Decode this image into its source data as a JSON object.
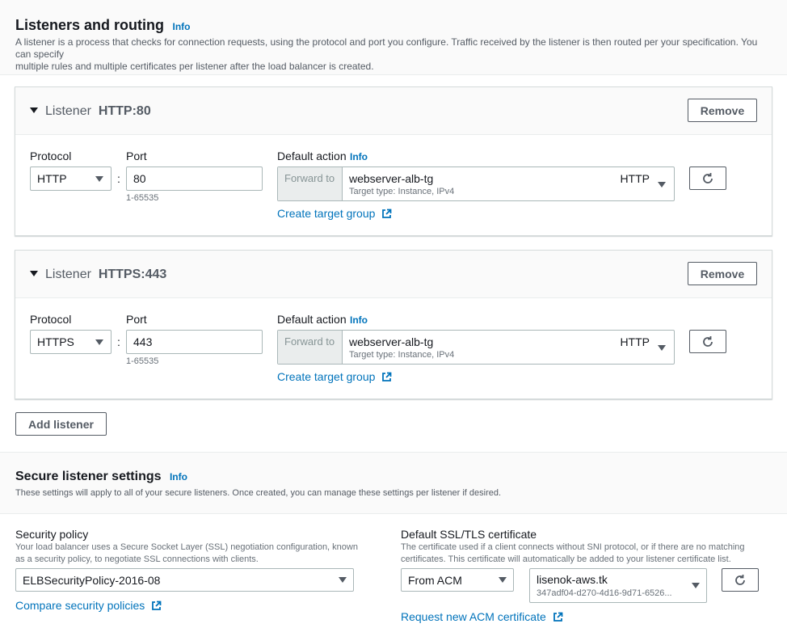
{
  "listeners_section": {
    "title": "Listeners and routing",
    "info": "Info",
    "description_1": "A listener is a process that checks for connection requests, using the protocol and port you configure. Traffic received by the listener is then routed per your specification. You can specify",
    "description_2": "multiple rules and multiple certificates per listener after the load balancer is created."
  },
  "listeners": [
    {
      "title_prefix": "Listener",
      "title_value": "HTTP:80",
      "remove_label": "Remove",
      "protocol_label": "Protocol",
      "protocol_value": "HTTP",
      "port_label": "Port",
      "port_value": "80",
      "port_hint": "1-65535",
      "default_action_label": "Default action",
      "info": "Info",
      "forward_to": "Forward to",
      "target_group": "webserver-alb-tg",
      "target_type": "Target type: Instance, IPv4",
      "target_protocol": "HTTP",
      "create_target_group": "Create target group"
    },
    {
      "title_prefix": "Listener",
      "title_value": "HTTPS:443",
      "remove_label": "Remove",
      "protocol_label": "Protocol",
      "protocol_value": "HTTPS",
      "port_label": "Port",
      "port_value": "443",
      "port_hint": "1-65535",
      "default_action_label": "Default action",
      "info": "Info",
      "forward_to": "Forward to",
      "target_group": "webserver-alb-tg",
      "target_type": "Target type: Instance, IPv4",
      "target_protocol": "HTTP",
      "create_target_group": "Create target group"
    }
  ],
  "add_listener_label": "Add listener",
  "secure_section": {
    "title": "Secure listener settings",
    "info": "Info",
    "description": "These settings will apply to all of your secure listeners. Once created, you can manage these settings per listener if desired."
  },
  "security_policy": {
    "label": "Security policy",
    "description_1": "Your load balancer uses a Secure Socket Layer (SSL) negotiation configuration, known",
    "description_2": "as a security policy, to negotiate SSL connections with clients.",
    "value": "ELBSecurityPolicy-2016-08",
    "compare_link": "Compare security policies"
  },
  "certificate": {
    "label": "Default SSL/TLS certificate",
    "description_1": "The certificate used if a client connects without SNI protocol, or if there are no matching",
    "description_2": "certificates. This certificate will automatically be added to your listener certificate list.",
    "source_value": "From ACM",
    "cert_name": "lisenok-aws.tk",
    "cert_id": "347adf04-d270-4d16-9d71-6526...",
    "request_link": "Request new ACM certificate"
  },
  "colors": {
    "link": "#0073bb",
    "border": "#aab7b8",
    "text": "#16191f",
    "muted": "#687078",
    "header_bg": "#fafafa"
  },
  "icons": [
    "caret-down-icon",
    "chevron-down-icon",
    "refresh-icon",
    "external-link-icon"
  ]
}
